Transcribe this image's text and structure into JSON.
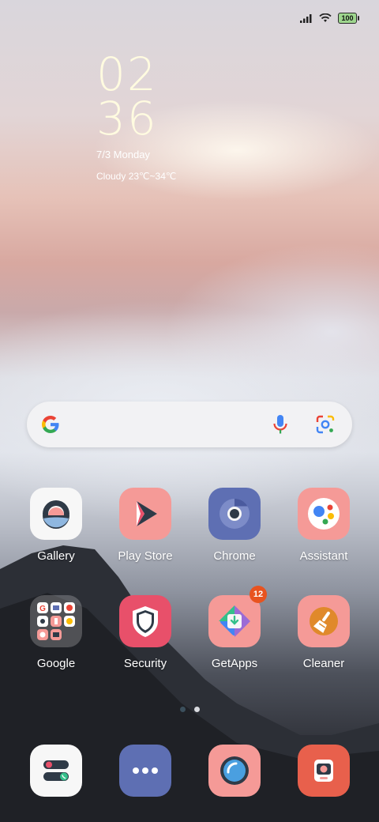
{
  "status_bar": {
    "battery": "100"
  },
  "clock": {
    "hours": "02",
    "minutes": "36",
    "date": "7/3 Monday",
    "weather": "Cloudy 23℃~34℃"
  },
  "search": {
    "logo_letter": "G"
  },
  "apps": [
    {
      "label": "Gallery"
    },
    {
      "label": "Play Store"
    },
    {
      "label": "Chrome"
    },
    {
      "label": "Assistant"
    },
    {
      "label": "Google"
    },
    {
      "label": "Security"
    },
    {
      "label": "GetApps",
      "badge": "12"
    },
    {
      "label": "Cleaner"
    }
  ],
  "colors": {
    "accent_salmon": "#f59a97",
    "accent_slate": "#5e6fb3",
    "accent_red": "#e8506a",
    "badge": "#e8531f",
    "clock_text": "#fffbe0"
  }
}
